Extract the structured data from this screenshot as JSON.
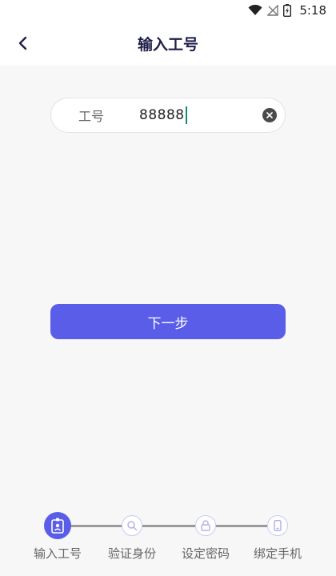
{
  "status_bar": {
    "time": "5:18"
  },
  "header": {
    "title": "输入工号"
  },
  "form": {
    "label": "工号",
    "value": "88888",
    "next_button": "下一步"
  },
  "steps": [
    {
      "label": "输入工号",
      "active": true,
      "icon": "badge-icon"
    },
    {
      "label": "验证身份",
      "active": false,
      "icon": "search-icon"
    },
    {
      "label": "设定密码",
      "active": false,
      "icon": "lock-icon"
    },
    {
      "label": "绑定手机",
      "active": false,
      "icon": "phone-icon"
    }
  ],
  "colors": {
    "accent": "#5a5de8",
    "title": "#1e1e48",
    "background": "#f7f7f8",
    "caret": "#0a8f7a"
  }
}
